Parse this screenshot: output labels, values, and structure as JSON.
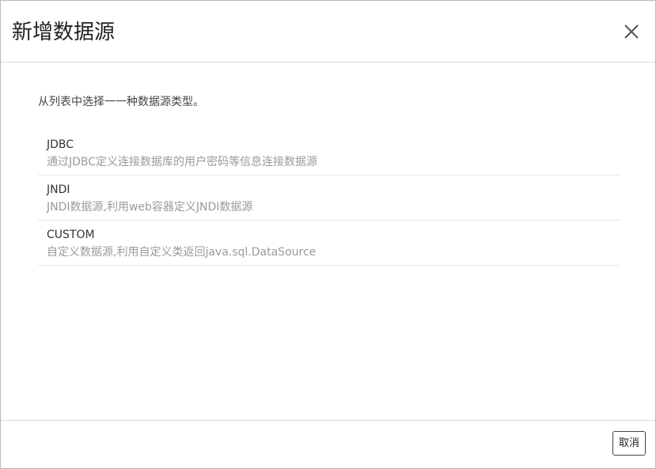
{
  "dialog": {
    "title": "新增数据源",
    "close_icon": "close-icon"
  },
  "body": {
    "hint": "从列表中选择一一种数据源类型。",
    "items": [
      {
        "name": "JDBC",
        "description": "通过JDBC定义连接数据库的用户密码等信息连接数据源"
      },
      {
        "name": "JNDI",
        "description": "JNDI数据源,利用web容器定义JNDI数据源"
      },
      {
        "name": "CUSTOM",
        "description": "自定义数据源,利用自定义类返回java.sql.DataSource"
      }
    ]
  },
  "footer": {
    "cancel_label": "取消"
  }
}
